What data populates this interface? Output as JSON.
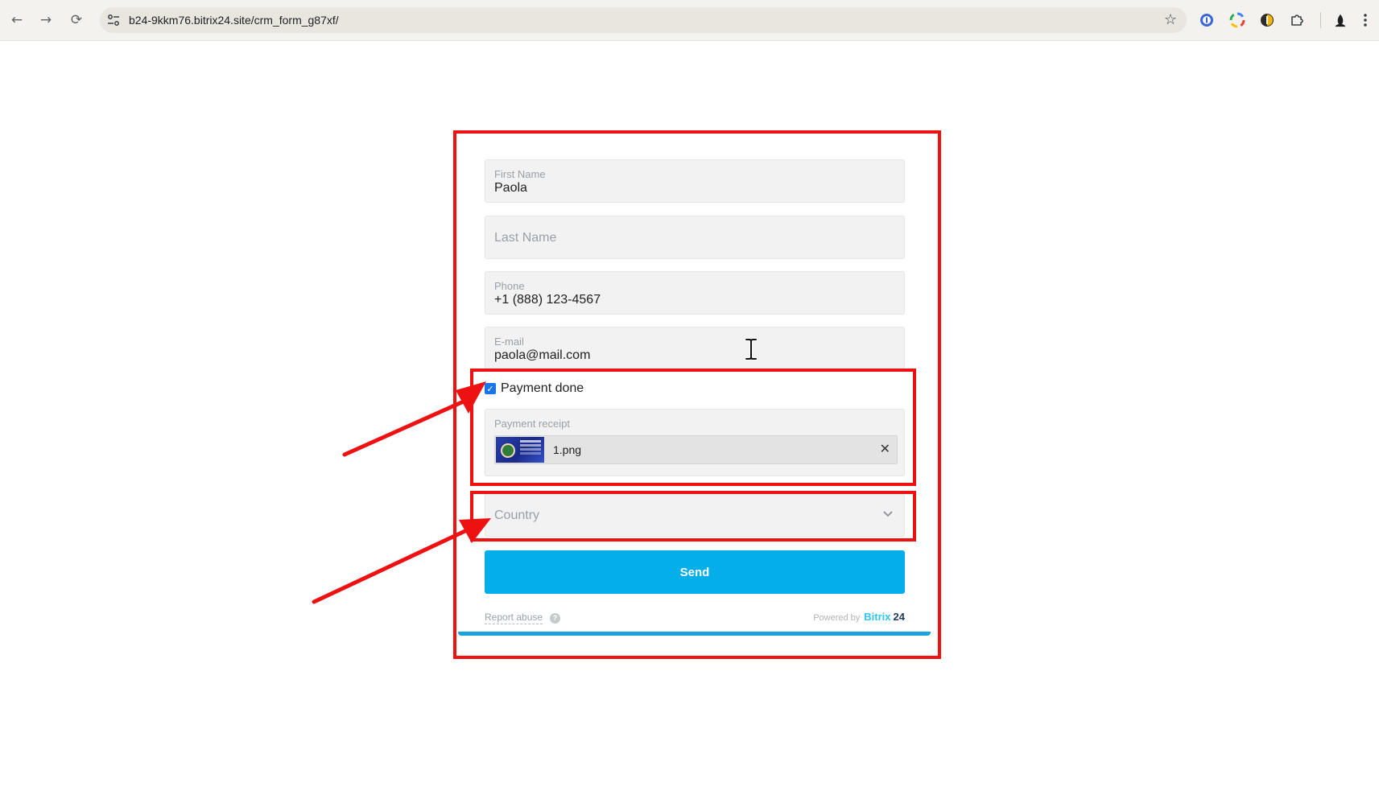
{
  "browser": {
    "back_glyph": "←",
    "forward_glyph": "→",
    "reload_glyph": "⟳",
    "url": "b24-9kkm76.bitrix24.site/crm_form_g87xf/",
    "bookmark_glyph": "☆"
  },
  "form": {
    "first_name": {
      "label": "First Name",
      "value": "Paola"
    },
    "last_name": {
      "placeholder": "Last Name"
    },
    "phone": {
      "label": "Phone",
      "value": "+1 (888) 123-4567"
    },
    "email": {
      "label": "E-mail",
      "value": "paola@mail.com"
    },
    "payment_done": {
      "label": "Payment done",
      "checked": true,
      "check_glyph": "✓"
    },
    "payment_receipt": {
      "label": "Payment receipt",
      "file_name": "1.png",
      "remove_glyph": "✕"
    },
    "country": {
      "placeholder": "Country"
    },
    "send_label": "Send",
    "footer": {
      "report_abuse": "Report abuse",
      "help_glyph": "?",
      "powered_by": "Powered by",
      "brand_name": "Bitrix",
      "brand_num": "24"
    }
  },
  "colors": {
    "annotation": "#ee1111",
    "send_button": "#04aee9",
    "brand": "#2fc6f6"
  }
}
